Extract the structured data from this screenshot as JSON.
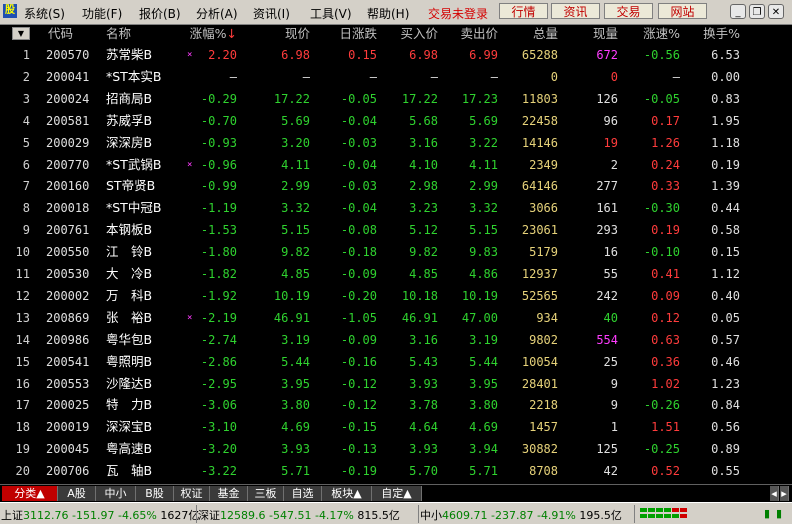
{
  "menubar": {
    "items": [
      "系统(S)",
      "功能(F)",
      "报价(B)",
      "分析(A)",
      "资讯(I)",
      "工具(V)",
      "帮助(H)"
    ],
    "alert": "交易未登录",
    "buttons": [
      "行情",
      "资讯",
      "交易",
      "网站"
    ]
  },
  "colors": {
    "up": "#ff3c3c",
    "down": "#2fd22f",
    "neutral": "#e0e0e0",
    "code": "#e0e0e0",
    "name": "#ffffff",
    "volume": "#e6d27a",
    "magenta": "#ff3cff",
    "background": "#000000"
  },
  "columns": [
    "代码",
    "名称",
    "涨幅%",
    "现价",
    "日涨跌",
    "买入价",
    "卖出价",
    "总量",
    "现量",
    "涨速%",
    "换手%"
  ],
  "sort_arrow": "↓",
  "rows": [
    {
      "n": "1",
      "code": "200570",
      "name": "苏常柴B",
      "mark": "×",
      "chg": "2.20",
      "price": "6.98",
      "diff": "0.15",
      "bid": "6.98",
      "ask": "6.99",
      "vol": "65288",
      "cur": "672",
      "spd": "-0.56",
      "turn": "6.53",
      "dir": "up",
      "spd_dir": "down",
      "cur_color": "magenta"
    },
    {
      "n": "2",
      "code": "200041",
      "name": "*ST本实B",
      "mark": "",
      "chg": "—",
      "price": "—",
      "diff": "—",
      "bid": "—",
      "ask": "—",
      "vol": "0",
      "cur": "0",
      "spd": "—",
      "turn": "0.00",
      "dir": "flat",
      "spd_dir": "flat",
      "cur_color": "up"
    },
    {
      "n": "3",
      "code": "200024",
      "name": "招商局B",
      "mark": "",
      "chg": "-0.29",
      "price": "17.22",
      "diff": "-0.05",
      "bid": "17.22",
      "ask": "17.23",
      "vol": "11803",
      "cur": "126",
      "spd": "-0.05",
      "turn": "0.83",
      "dir": "down",
      "spd_dir": "down",
      "cur_color": "neutral"
    },
    {
      "n": "4",
      "code": "200581",
      "name": "苏威孚B",
      "mark": "",
      "chg": "-0.70",
      "price": "5.69",
      "diff": "-0.04",
      "bid": "5.68",
      "ask": "5.69",
      "vol": "22458",
      "cur": "96",
      "spd": "0.17",
      "turn": "1.95",
      "dir": "down",
      "spd_dir": "up",
      "cur_color": "neutral"
    },
    {
      "n": "5",
      "code": "200029",
      "name": "深深房B",
      "mark": "",
      "chg": "-0.93",
      "price": "3.20",
      "diff": "-0.03",
      "bid": "3.16",
      "ask": "3.22",
      "vol": "14146",
      "cur": "19",
      "spd": "1.26",
      "turn": "1.18",
      "dir": "down",
      "spd_dir": "up",
      "cur_color": "up"
    },
    {
      "n": "6",
      "code": "200770",
      "name": "*ST武锅B",
      "mark": "×",
      "chg": "-0.96",
      "price": "4.11",
      "diff": "-0.04",
      "bid": "4.10",
      "ask": "4.11",
      "vol": "2349",
      "cur": "2",
      "spd": "0.24",
      "turn": "0.19",
      "dir": "down",
      "spd_dir": "up",
      "cur_color": "neutral"
    },
    {
      "n": "7",
      "code": "200160",
      "name": "ST帝贤B",
      "mark": "",
      "chg": "-0.99",
      "price": "2.99",
      "diff": "-0.03",
      "bid": "2.98",
      "ask": "2.99",
      "vol": "64146",
      "cur": "277",
      "spd": "0.33",
      "turn": "1.39",
      "dir": "down",
      "spd_dir": "up",
      "cur_color": "neutral"
    },
    {
      "n": "8",
      "code": "200018",
      "name": "*ST中冠B",
      "mark": "",
      "chg": "-1.19",
      "price": "3.32",
      "diff": "-0.04",
      "bid": "3.23",
      "ask": "3.32",
      "vol": "3066",
      "cur": "161",
      "spd": "-0.30",
      "turn": "0.44",
      "dir": "down",
      "spd_dir": "down",
      "cur_color": "neutral"
    },
    {
      "n": "9",
      "code": "200761",
      "name": "本钢板B",
      "mark": "",
      "chg": "-1.53",
      "price": "5.15",
      "diff": "-0.08",
      "bid": "5.12",
      "ask": "5.15",
      "vol": "23061",
      "cur": "293",
      "spd": "0.19",
      "turn": "0.58",
      "dir": "down",
      "spd_dir": "up",
      "cur_color": "neutral"
    },
    {
      "n": "10",
      "code": "200550",
      "name": "江　铃B",
      "mark": "",
      "chg": "-1.80",
      "price": "9.82",
      "diff": "-0.18",
      "bid": "9.82",
      "ask": "9.83",
      "vol": "5179",
      "cur": "16",
      "spd": "-0.10",
      "turn": "0.15",
      "dir": "down",
      "spd_dir": "down",
      "cur_color": "neutral"
    },
    {
      "n": "11",
      "code": "200530",
      "name": "大　冷B",
      "mark": "",
      "chg": "-1.82",
      "price": "4.85",
      "diff": "-0.09",
      "bid": "4.85",
      "ask": "4.86",
      "vol": "12937",
      "cur": "55",
      "spd": "0.41",
      "turn": "1.12",
      "dir": "down",
      "spd_dir": "up",
      "cur_color": "neutral"
    },
    {
      "n": "12",
      "code": "200002",
      "name": "万　科B",
      "mark": "",
      "chg": "-1.92",
      "price": "10.19",
      "diff": "-0.20",
      "bid": "10.18",
      "ask": "10.19",
      "vol": "52565",
      "cur": "242",
      "spd": "0.09",
      "turn": "0.40",
      "dir": "down",
      "spd_dir": "up",
      "cur_color": "neutral"
    },
    {
      "n": "13",
      "code": "200869",
      "name": "张　裕B",
      "mark": "×",
      "chg": "-2.19",
      "price": "46.91",
      "diff": "-1.05",
      "bid": "46.91",
      "ask": "47.00",
      "vol": "934",
      "cur": "40",
      "spd": "0.12",
      "turn": "0.05",
      "dir": "down",
      "spd_dir": "up",
      "cur_color": "down"
    },
    {
      "n": "14",
      "code": "200986",
      "name": "粤华包B",
      "mark": "",
      "chg": "-2.74",
      "price": "3.19",
      "diff": "-0.09",
      "bid": "3.16",
      "ask": "3.19",
      "vol": "9802",
      "cur": "554",
      "spd": "0.63",
      "turn": "0.57",
      "dir": "down",
      "spd_dir": "up",
      "cur_color": "magenta"
    },
    {
      "n": "15",
      "code": "200541",
      "name": "粤照明B",
      "mark": "",
      "chg": "-2.86",
      "price": "5.44",
      "diff": "-0.16",
      "bid": "5.43",
      "ask": "5.44",
      "vol": "10054",
      "cur": "25",
      "spd": "0.36",
      "turn": "0.46",
      "dir": "down",
      "spd_dir": "up",
      "cur_color": "neutral"
    },
    {
      "n": "16",
      "code": "200553",
      "name": "沙隆达B",
      "mark": "",
      "chg": "-2.95",
      "price": "3.95",
      "diff": "-0.12",
      "bid": "3.93",
      "ask": "3.95",
      "vol": "28401",
      "cur": "9",
      "spd": "1.02",
      "turn": "1.23",
      "dir": "down",
      "spd_dir": "up",
      "cur_color": "neutral"
    },
    {
      "n": "17",
      "code": "200025",
      "name": "特　力B",
      "mark": "",
      "chg": "-3.06",
      "price": "3.80",
      "diff": "-0.12",
      "bid": "3.78",
      "ask": "3.80",
      "vol": "2218",
      "cur": "9",
      "spd": "-0.26",
      "turn": "0.84",
      "dir": "down",
      "spd_dir": "down",
      "cur_color": "neutral"
    },
    {
      "n": "18",
      "code": "200019",
      "name": "深深宝B",
      "mark": "",
      "chg": "-3.10",
      "price": "4.69",
      "diff": "-0.15",
      "bid": "4.64",
      "ask": "4.69",
      "vol": "1457",
      "cur": "1",
      "spd": "1.51",
      "turn": "0.56",
      "dir": "down",
      "spd_dir": "up",
      "cur_color": "neutral"
    },
    {
      "n": "19",
      "code": "200045",
      "name": "粤高速B",
      "mark": "",
      "chg": "-3.20",
      "price": "3.93",
      "diff": "-0.13",
      "bid": "3.93",
      "ask": "3.94",
      "vol": "30882",
      "cur": "125",
      "spd": "-0.25",
      "turn": "0.89",
      "dir": "down",
      "spd_dir": "down",
      "cur_color": "neutral"
    },
    {
      "n": "20",
      "code": "200706",
      "name": "瓦　轴B",
      "mark": "",
      "chg": "-3.22",
      "price": "5.71",
      "diff": "-0.19",
      "bid": "5.70",
      "ask": "5.71",
      "vol": "8708",
      "cur": "42",
      "spd": "0.52",
      "turn": "0.55",
      "dir": "down",
      "spd_dir": "up",
      "cur_color": "neutral"
    }
  ],
  "tabs": [
    "分类▲",
    "A股",
    "中小",
    "B股",
    "权证",
    "基金",
    "三板",
    "自选",
    "板块▲",
    "自定▲"
  ],
  "status": {
    "sh_label": "上证",
    "sh_value": "3112.76",
    "sh_change": "-151.97",
    "sh_pct": "-4.65%",
    "sh_amount": "1627亿",
    "sz_label": "深证",
    "sz_value": "12589.6",
    "sz_change": "-547.51",
    "sz_pct": "-4.17%",
    "sz_amount": "815.5亿",
    "zx_label": "中小",
    "zx_value": "4609.71",
    "zx_change": "-237.87",
    "zx_pct": "-4.91%",
    "zx_amount": "195.5亿"
  }
}
